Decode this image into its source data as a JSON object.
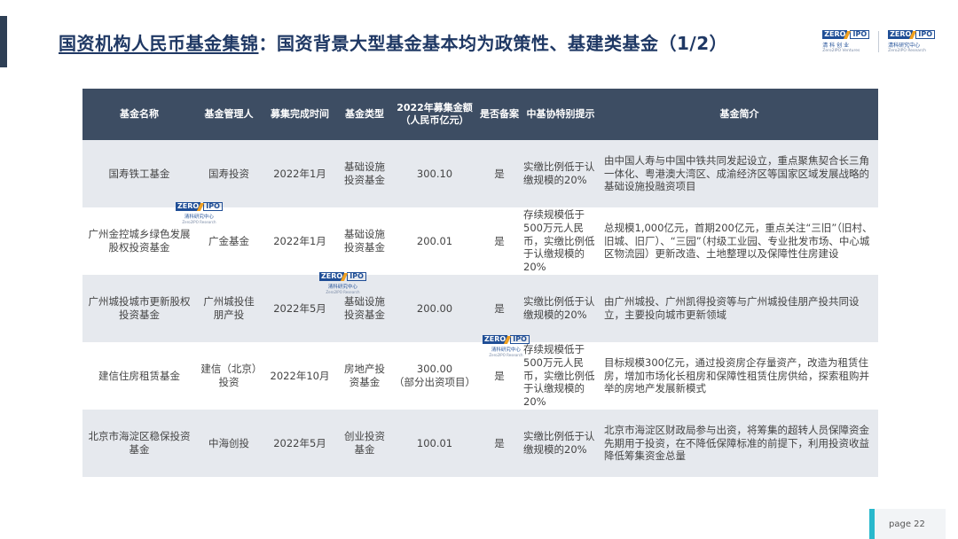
{
  "header": {
    "title_main": "国资机构人民币基金集锦",
    "title_rest": "：国资背景大型基金基本均为政策性、基建类基金（1/2）"
  },
  "logos": {
    "left": {
      "mark_left": "ZERO",
      "mark_right": "IPO",
      "cn": "清 科 创 业",
      "en": "Zero2IPO Ventures"
    },
    "right": {
      "mark_left": "ZERO",
      "mark_right": "IPO",
      "cn": "清科研究中心",
      "en": "Zero2IPO Research"
    }
  },
  "watermark": {
    "mark_left": "ZERO",
    "mark_right": "IPO",
    "cn": "清科研究中心",
    "en": "Zero2IPO Research"
  },
  "table": {
    "headers": [
      "基金名称",
      "基金管理人",
      "募集完成时间",
      "基金类型",
      "2022年募集金额\n（人民币亿元）",
      "是否备案",
      "中基协特别提示",
      "基金简介"
    ],
    "rows": [
      {
        "name": "国寿铁工基金",
        "manager": "国寿投资",
        "date": "2022年1月",
        "type": "基础设施投资基金",
        "amount": "300.10",
        "filed": "是",
        "notice": "实缴比例低于认缴规模的20%",
        "intro": "由中国人寿与中国中铁共同发起设立，重点聚焦契合长三角一体化、粤港澳大湾区、成渝经济区等国家区域发展战略的基础设施投融资项目"
      },
      {
        "name": "广州金控城乡绿色发展股权投资基金",
        "manager": "广金基金",
        "date": "2022年1月",
        "type": "基础设施投资基金",
        "amount": "200.01",
        "filed": "是",
        "notice": "存续规模低于500万元人民币，实缴比例低于认缴规模的20%",
        "intro": "总规模1,000亿元，首期200亿元，重点关注“三旧”（旧村、旧城、旧厂）、“三园”（村级工业园、专业批发市场、中心城区物流园）更新改造、土地整理以及保障性住房建设"
      },
      {
        "name": "广州城投城市更新股权投资基金",
        "manager": "广州城投佳朋产投",
        "date": "2022年5月",
        "type": "基础设施投资基金",
        "amount": "200.00",
        "filed": "是",
        "notice": "实缴比例低于认缴规模的20%",
        "intro": "由广州城投、广州凯得投资等与广州城投佳朋产投共同设立，主要投向城市更新领域"
      },
      {
        "name": "建信住房租赁基金",
        "manager": "建信（北京）投资",
        "date": "2022年10月",
        "type": "房地产投资基金",
        "amount": "300.00\n（部分出资项目）",
        "filed": "是",
        "notice": "存续规模低于500万元人民币，实缴比例低于认缴规模的20%",
        "intro": "目标规模300亿元，通过投资房企存量资产，改造为租赁住房，增加市场化长租房和保障性租赁住房供给，探索租购并举的房地产发展新模式"
      },
      {
        "name": "北京市海淀区稳保投资基金",
        "manager": "中海创投",
        "date": "2022年5月",
        "type": "创业投资基金",
        "amount": "100.01",
        "filed": "是",
        "notice": "实缴比例低于认缴规模的20%",
        "intro": "北京市海淀区财政局参与出资，将筹集的超转人员保障资金先期用于投资，在不降低保障标准的前提下，利用投资收益降低筹集资金总量"
      }
    ]
  },
  "footer": {
    "page_label": "page  22"
  }
}
